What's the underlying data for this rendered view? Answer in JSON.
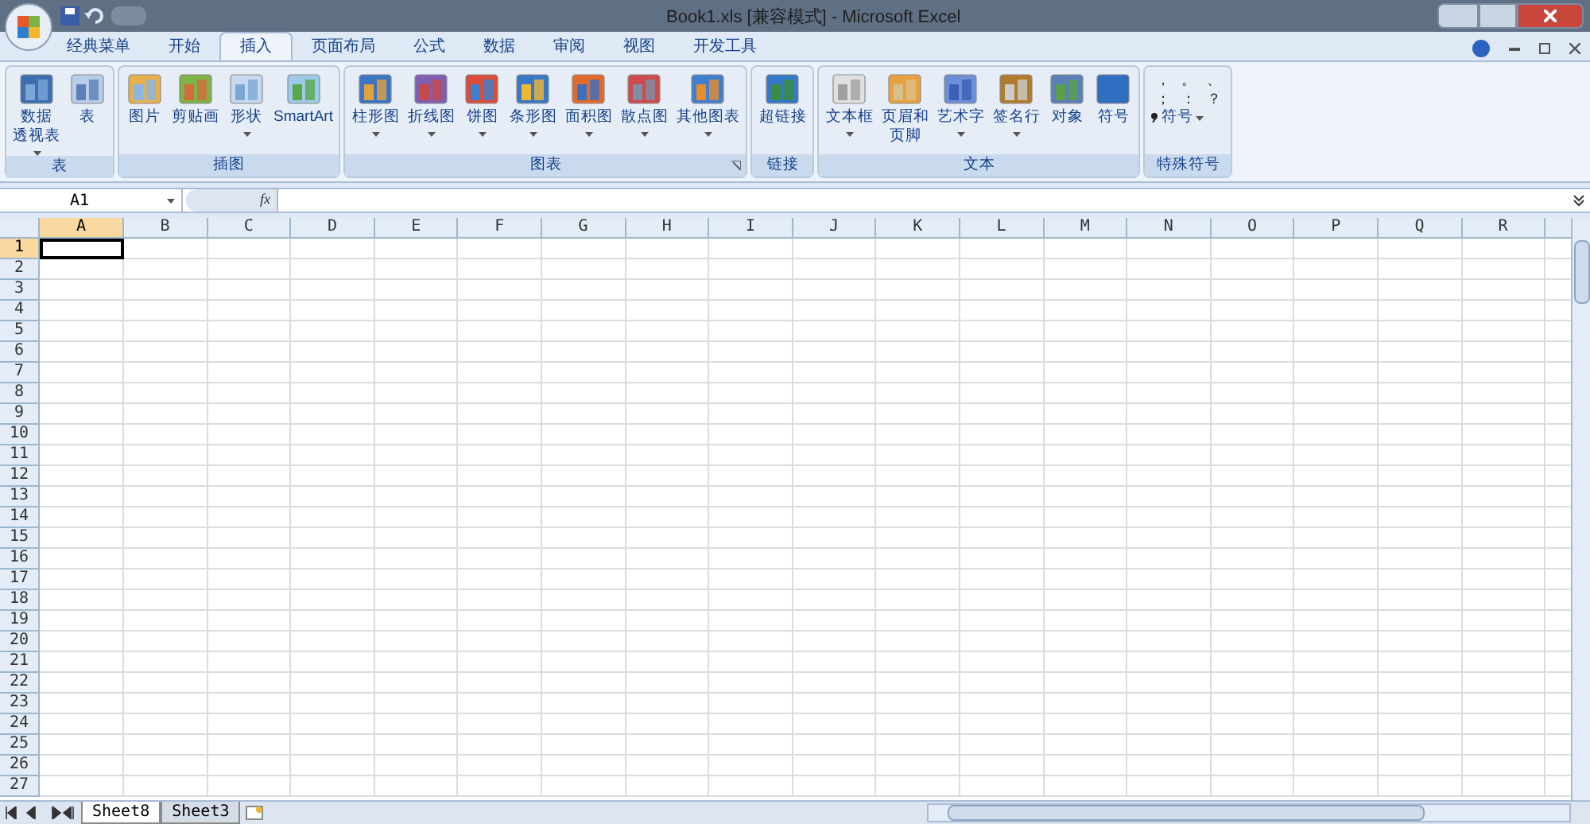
{
  "window": {
    "title": "Book1.xls  [兼容模式] - Microsoft Excel"
  },
  "tabs": [
    {
      "label": "经典菜单",
      "selected": false
    },
    {
      "label": "开始",
      "selected": false
    },
    {
      "label": "插入",
      "selected": true
    },
    {
      "label": "页面布局",
      "selected": false
    },
    {
      "label": "公式",
      "selected": false
    },
    {
      "label": "数据",
      "selected": false
    },
    {
      "label": "审阅",
      "selected": false
    },
    {
      "label": "视图",
      "selected": false
    },
    {
      "label": "开发工具",
      "selected": false
    }
  ],
  "ribbon_groups": [
    {
      "label": "表",
      "launcher": false,
      "items": [
        {
          "lines": [
            "数据",
            "透视表"
          ],
          "dropdown": true
        },
        {
          "lines": [
            "表"
          ],
          "dropdown": false
        }
      ]
    },
    {
      "label": "插图",
      "launcher": false,
      "items": [
        {
          "lines": [
            "图片"
          ],
          "dropdown": false
        },
        {
          "lines": [
            "剪贴画"
          ],
          "dropdown": false
        },
        {
          "lines": [
            "形状"
          ],
          "dropdown": true
        },
        {
          "lines": [
            "SmartArt"
          ],
          "dropdown": false
        }
      ]
    },
    {
      "label": "图表",
      "launcher": true,
      "items": [
        {
          "lines": [
            "柱形图"
          ],
          "dropdown": true
        },
        {
          "lines": [
            "折线图"
          ],
          "dropdown": true
        },
        {
          "lines": [
            "饼图"
          ],
          "dropdown": true
        },
        {
          "lines": [
            "条形图"
          ],
          "dropdown": true
        },
        {
          "lines": [
            "面积图"
          ],
          "dropdown": true
        },
        {
          "lines": [
            "散点图"
          ],
          "dropdown": true
        },
        {
          "lines": [
            "其他图表"
          ],
          "dropdown": true
        }
      ]
    },
    {
      "label": "链接",
      "launcher": false,
      "items": [
        {
          "lines": [
            "超链接"
          ],
          "dropdown": false
        }
      ]
    },
    {
      "label": "文本",
      "launcher": false,
      "items": [
        {
          "lines": [
            "文本框"
          ],
          "dropdown": true
        },
        {
          "lines": [
            "页眉和",
            "页脚"
          ],
          "dropdown": false
        },
        {
          "lines": [
            "艺术字"
          ],
          "dropdown": true
        },
        {
          "lines": [
            "签名行"
          ],
          "dropdown": true
        },
        {
          "lines": [
            "对象"
          ],
          "dropdown": false
        },
        {
          "lines": [
            "符号"
          ],
          "dropdown": false
        }
      ]
    }
  ],
  "special_symbols": {
    "label": "特殊符号",
    "symbols": [
      "，",
      "。",
      "、",
      "；",
      "：",
      "？"
    ],
    "button": "符号"
  },
  "name_box": "A1",
  "fx": "fx",
  "columns": [
    {
      "label": "A",
      "selected": true
    },
    {
      "label": "B",
      "selected": false
    },
    {
      "label": "C",
      "selected": false
    },
    {
      "label": "D",
      "selected": false
    },
    {
      "label": "E",
      "selected": false
    },
    {
      "label": "F",
      "selected": false
    },
    {
      "label": "G",
      "selected": false
    },
    {
      "label": "H",
      "selected": false
    },
    {
      "label": "I",
      "selected": false
    },
    {
      "label": "J",
      "selected": false
    },
    {
      "label": "K",
      "selected": false
    },
    {
      "label": "L",
      "selected": false
    },
    {
      "label": "M",
      "selected": false
    },
    {
      "label": "N",
      "selected": false
    },
    {
      "label": "O",
      "selected": false
    },
    {
      "label": "P",
      "selected": false
    },
    {
      "label": "Q",
      "selected": false
    },
    {
      "label": "R",
      "selected": false
    }
  ],
  "rows": [
    {
      "label": "1",
      "selected": true
    },
    {
      "label": "2",
      "selected": false
    },
    {
      "label": "3",
      "selected": false
    },
    {
      "label": "4",
      "selected": false
    },
    {
      "label": "5",
      "selected": false
    },
    {
      "label": "6",
      "selected": false
    },
    {
      "label": "7",
      "selected": false
    },
    {
      "label": "8",
      "selected": false
    },
    {
      "label": "9",
      "selected": false
    },
    {
      "label": "10",
      "selected": false
    },
    {
      "label": "11",
      "selected": false
    },
    {
      "label": "12",
      "selected": false
    },
    {
      "label": "13",
      "selected": false
    },
    {
      "label": "14",
      "selected": false
    },
    {
      "label": "15",
      "selected": false
    },
    {
      "label": "16",
      "selected": false
    },
    {
      "label": "17",
      "selected": false
    },
    {
      "label": "18",
      "selected": false
    },
    {
      "label": "19",
      "selected": false
    },
    {
      "label": "20",
      "selected": false
    },
    {
      "label": "21",
      "selected": false
    },
    {
      "label": "22",
      "selected": false
    },
    {
      "label": "23",
      "selected": false
    },
    {
      "label": "24",
      "selected": false
    },
    {
      "label": "25",
      "selected": false
    },
    {
      "label": "26",
      "selected": false
    },
    {
      "label": "27",
      "selected": false
    }
  ],
  "sheet_tabs": [
    {
      "label": "Sheet8",
      "selected": true
    },
    {
      "label": "Sheet3",
      "selected": false
    }
  ]
}
